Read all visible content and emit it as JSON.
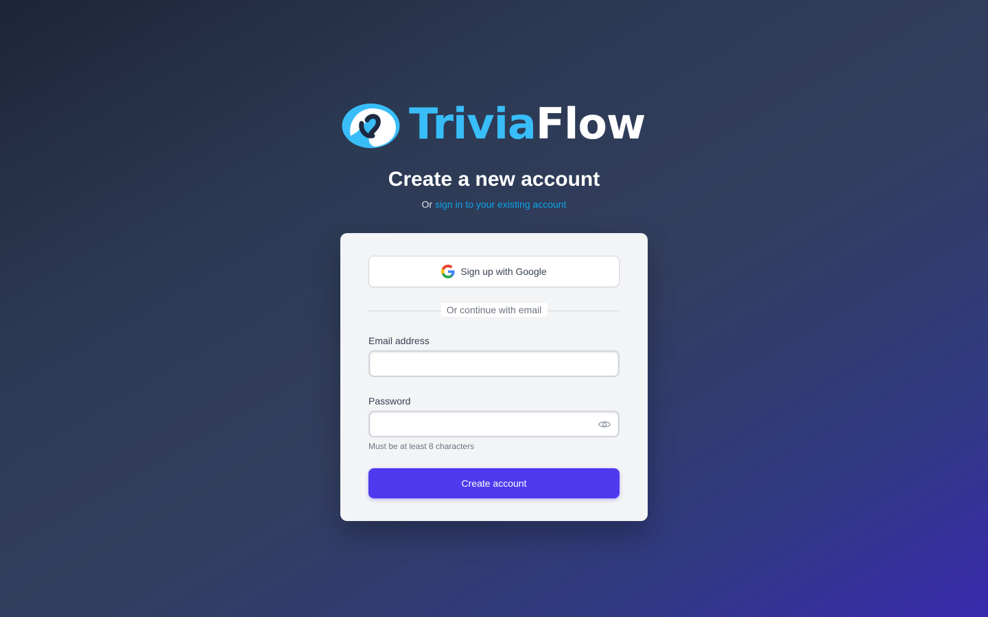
{
  "brand": {
    "name_part1": "Trivia",
    "name_part2": "Flow",
    "primary_color": "#38bdf8",
    "secondary_color": "#ffffff",
    "logo_icon": "swirl-logo-icon"
  },
  "header": {
    "title": "Create a new account",
    "subtitle_prefix": "Or",
    "signin_link": "sign in to your existing account"
  },
  "form": {
    "google_button": "Sign up with Google",
    "google_icon": "google-g-icon",
    "divider_text": "Or continue with email",
    "email_label": "Email address",
    "email_value": "",
    "password_label": "Password",
    "password_value": "",
    "password_toggle_icon": "eye-icon",
    "password_hint": "Must be at least 8 characters",
    "submit_button": "Create account"
  },
  "colors": {
    "accent": "#4f3af0",
    "link": "#0ea5e9",
    "card_bg": "#f3f4f6"
  }
}
